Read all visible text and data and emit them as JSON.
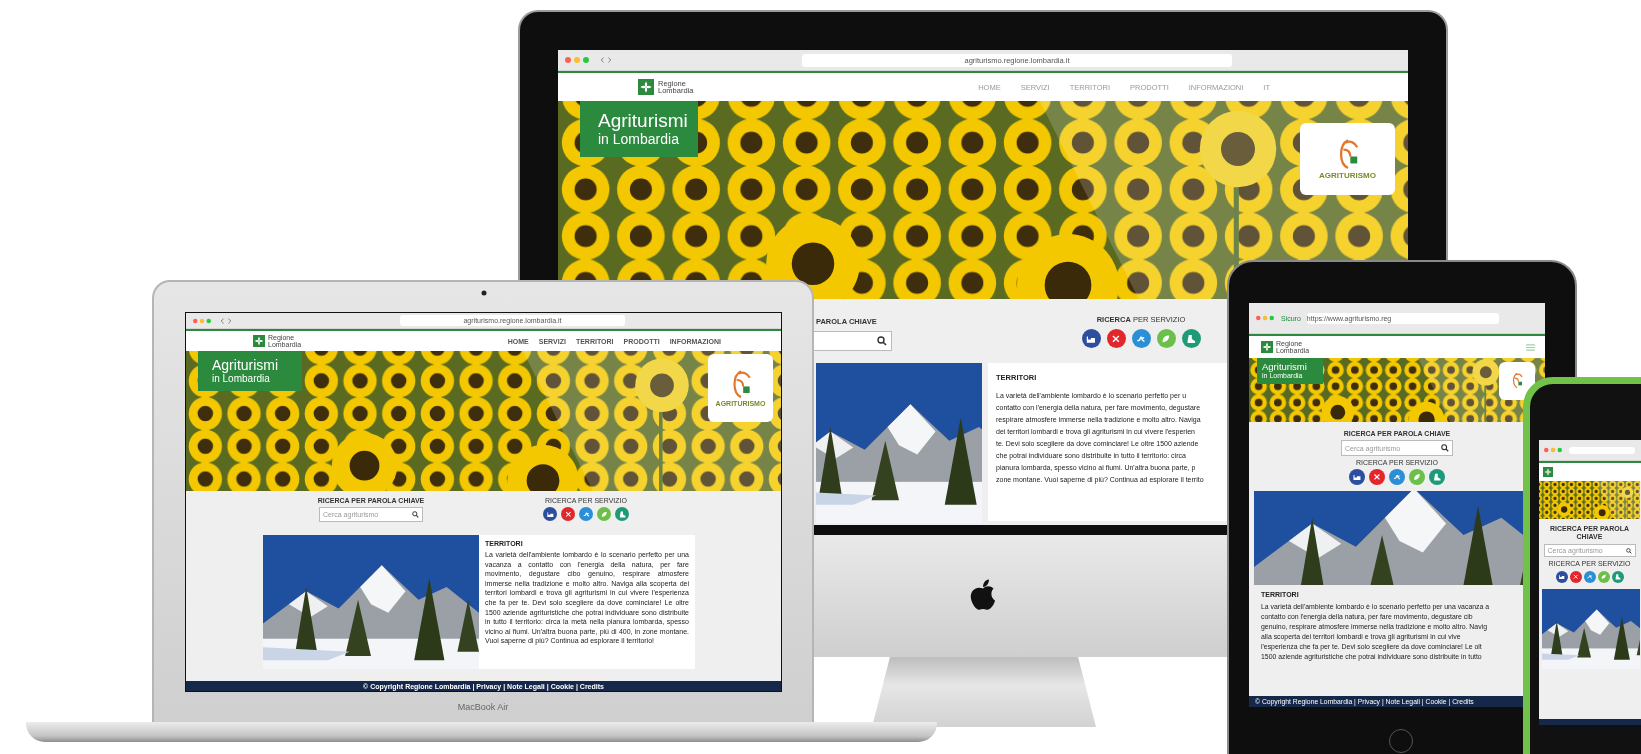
{
  "devices": [
    {
      "kind": "desktop",
      "browser": {
        "url": "agriturismo.regione.lombardia.it"
      },
      "logo": {
        "lines": [
          "Regione",
          "Lombardia"
        ]
      },
      "nav": [
        "HOME",
        "SERVIZI",
        "TERRITORI",
        "PRODOTTI",
        "INFORMAZIONI",
        "IT"
      ],
      "hero": {
        "title": "Agriturismi",
        "subtitle": "in Lombardia",
        "badge": "AGRITURISMO"
      },
      "keyword_heading": "PAROLA CHIAVE",
      "service_heading": "**RICERCA** PER SERVIZIO",
      "territory": {
        "title": "TERRITORI",
        "paragraph": "La varietà dell'ambiente lombardo è lo scenario perfetto per u\ncontatto con l'energia della natura, per fare movimento, degustare\nrespirare atmosfere immerse nella tradizione e molto altro. Naviga\ndei territori lombardi e trova gli agriturismi in cui vivere l'esperien\nte. Devi solo scegliere da dove cominciare! Le oltre 1500 aziende\nche potrai individuare sono distribuite in tutto il territorio: circa\npianura lombarda, spesso vicino ai fiumi. Un'altra buona parte, p\nzone montane. Vuoi saperne di più? Continua ad esplorare il territo"
      }
    },
    {
      "kind": "laptop",
      "label": "MacBook Air",
      "browser": {
        "url": "agriturismo.regione.lombardia.it"
      },
      "logo": {
        "lines": [
          "Regione",
          "Lombardia"
        ]
      },
      "nav": [
        "HOME",
        "SERVIZI",
        "TERRITORI",
        "PRODOTTI",
        "INFORMAZIONI"
      ],
      "hero": {
        "title": "Agriturismi",
        "subtitle": "in Lombardia",
        "badge": "AGRITURISMO"
      },
      "keyword_heading": "RICERCA PER PAROLA CHIAVE",
      "search": {
        "placeholder": "Cerca agriturismo"
      },
      "service_heading": "RICERCA PER SERVIZIO",
      "territory": {
        "title": "TERRITORI",
        "paragraph": "La varietà dell'ambiente lombardo è lo scenario perfetto per una vacanza a contatto con l'energia della natura, per fare movimento, degustare cibo genuino, respirare atmosfere immerse nella tradizione e molto altro. Naviga alla scoperta dei territori lombardi e trova gli agriturismi in cui vivere l'esperienza che fa per te. Devi solo scegliere da dove cominciare! Le oltre 1500 aziende agrituristiche che potrai individuare sono distribuite in tutto il territorio: circa la metà nella pianura lombarda, spesso vicino ai fiumi. Un'altra buona parte, più di 400, in zone montane. Vuoi saperne di più? Continua ad esplorare il territorio!"
      },
      "footer": "© Copyright Regione Lombardia | Privacy | Note Legali | Cookie | Credits"
    },
    {
      "kind": "tablet",
      "browser": {
        "secure": "Sicuro",
        "url": "https://www.agriturismo.reg"
      },
      "logo": {
        "lines": [
          "Regione",
          "Lombardia"
        ]
      },
      "hero": {
        "title": "Agriturismi",
        "subtitle": "in Lombardia"
      },
      "keyword_heading": "RICERCA PER PAROLA CHIAVE",
      "search": {
        "placeholder": "Cerca agriturismo"
      },
      "service_heading": "RICERCA PER SERVIZIO",
      "territory": {
        "title": "TERRITORI",
        "paragraph": "La varietà dell'ambiente lombardo è lo scenario perfetto per una vacanza a\ncontatto con l'energia della natura, per fare movimento, degustare cib\ngenuino, respirare atmosfere immerse nella tradizione e molto altro. Navig\nalla scoperta dei territori lombardi e trova gli agriturismi in cui vive\nl'esperienza che fa per te. Devi solo scegliere da dove cominciare! Le olt\n1500 aziende agrituristiche che potrai individuare sono distribuite in tutto"
      },
      "footer": "© Copyright Regione Lombardia | Privacy | Note Legali | Cookie | Credits"
    },
    {
      "kind": "phone",
      "keyword_heading": "RICERCA PER PAROLA CHIAVE",
      "search": {
        "placeholder": "Cerca agriturismo"
      },
      "service_heading": "RICERCA PER SERVIZIO"
    }
  ],
  "services": [
    {
      "kind": "bed",
      "color": "#2b4f9e"
    },
    {
      "kind": "food",
      "color": "#e3262b"
    },
    {
      "kind": "sport",
      "color": "#2a8fd6"
    },
    {
      "kind": "nature",
      "color": "#6cc04a"
    },
    {
      "kind": "hiking",
      "color": "#1f9a78"
    }
  ]
}
